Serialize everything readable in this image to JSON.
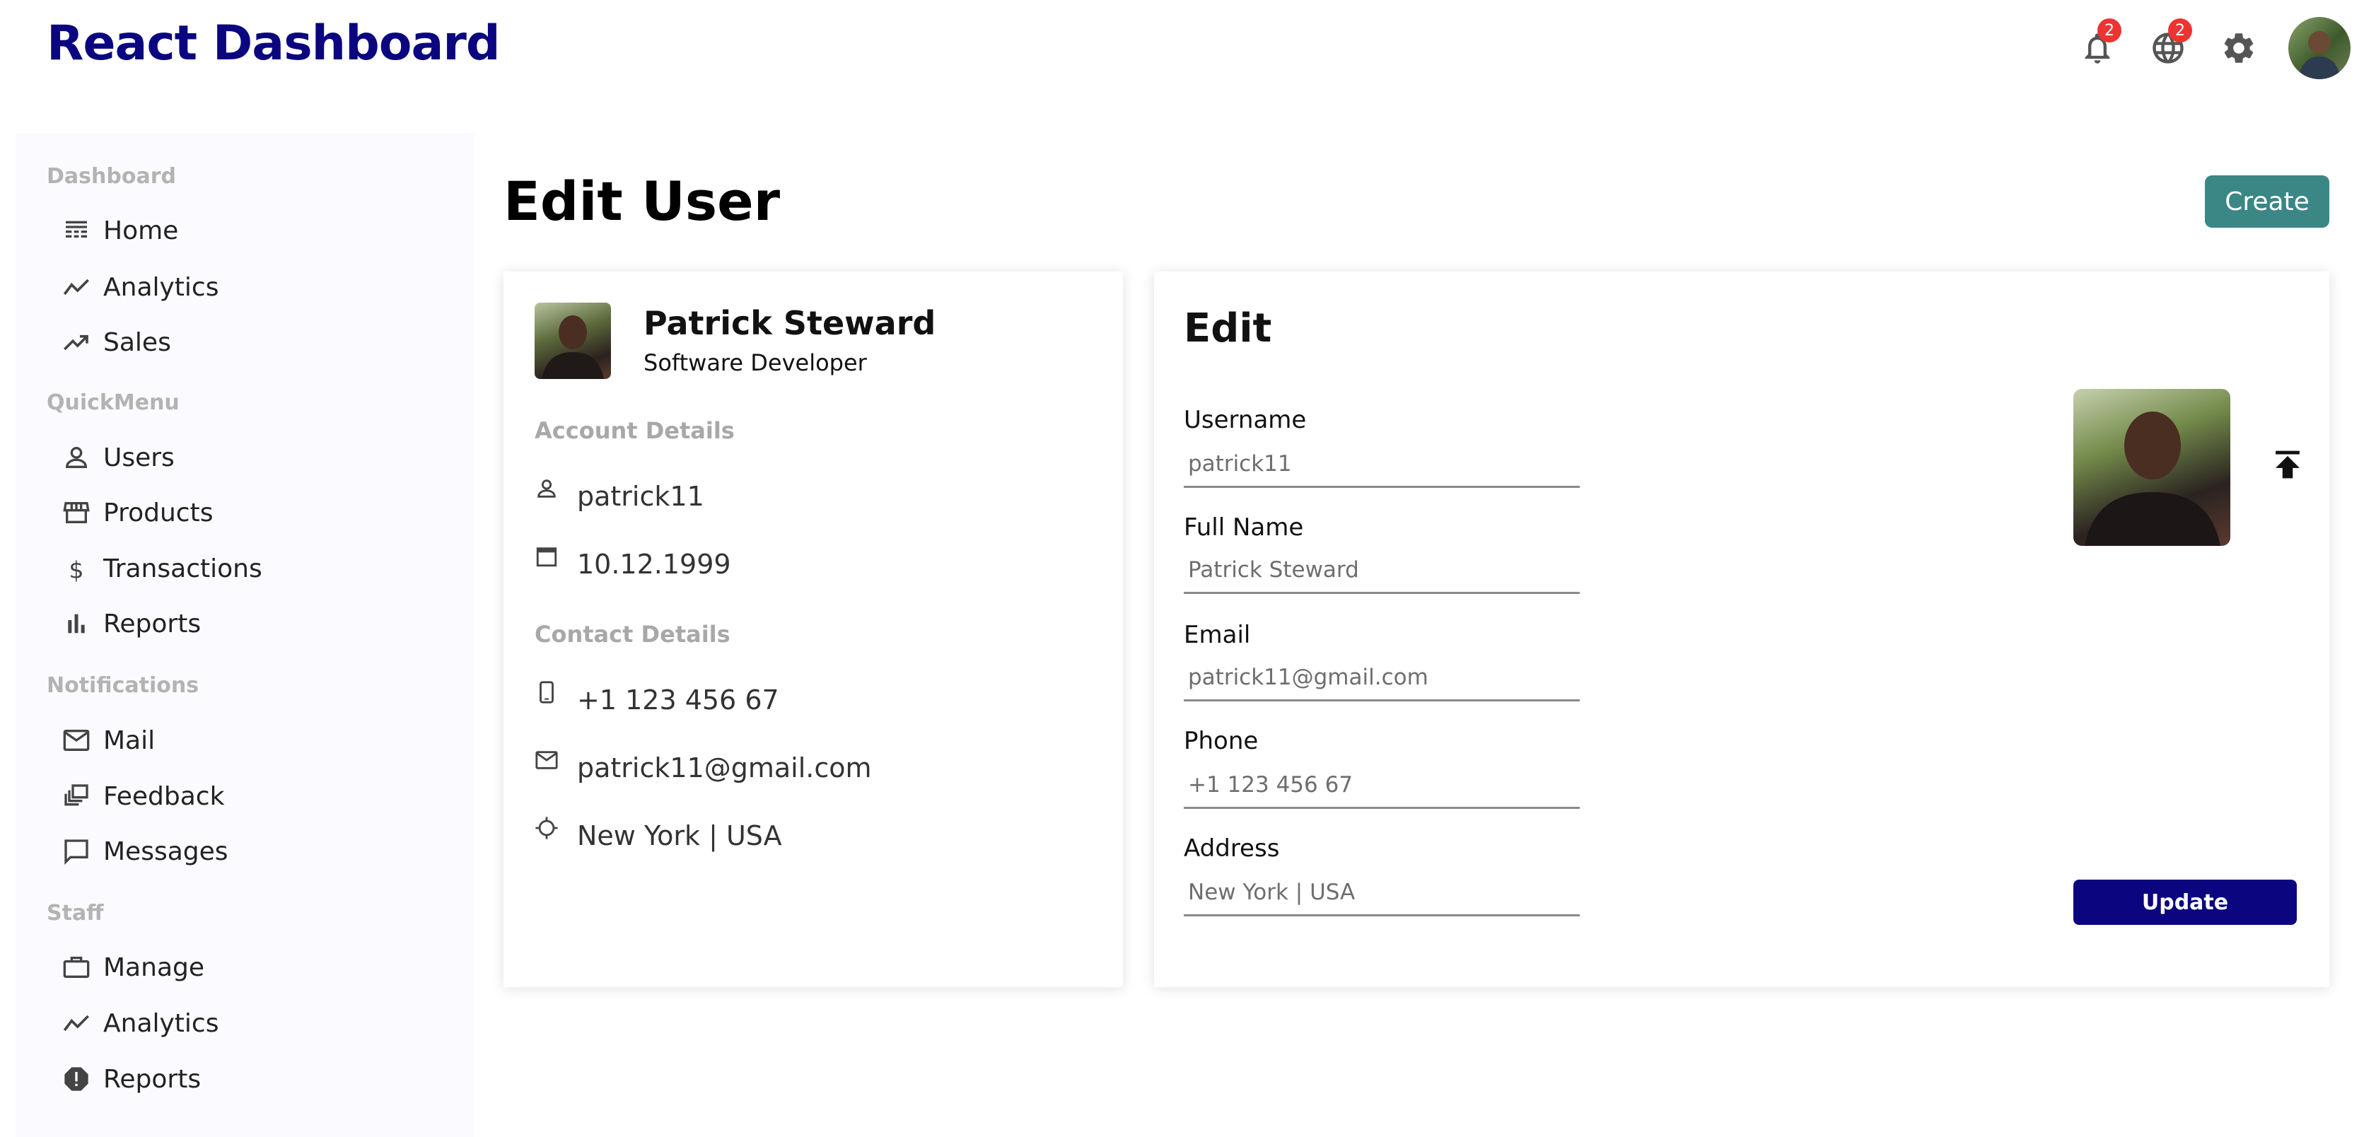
{
  "app": {
    "title": "React Dashboard"
  },
  "topbar": {
    "notifications_badge": "2",
    "language_badge": "2"
  },
  "sidebar": {
    "sections": [
      {
        "title": "Dashboard",
        "items": [
          {
            "label": "Home",
            "icon": "home-icon"
          },
          {
            "label": "Analytics",
            "icon": "timeline-icon"
          },
          {
            "label": "Sales",
            "icon": "trending-up-icon"
          }
        ]
      },
      {
        "title": "QuickMenu",
        "items": [
          {
            "label": "Users",
            "icon": "person-icon"
          },
          {
            "label": "Products",
            "icon": "storefront-icon"
          },
          {
            "label": "Transactions",
            "icon": "dollar-icon"
          },
          {
            "label": "Reports",
            "icon": "bar-chart-icon"
          }
        ]
      },
      {
        "title": "Notifications",
        "items": [
          {
            "label": "Mail",
            "icon": "mail-icon"
          },
          {
            "label": "Feedback",
            "icon": "dynamic-feed-icon"
          },
          {
            "label": "Messages",
            "icon": "chat-bubble-icon"
          }
        ]
      },
      {
        "title": "Staff",
        "items": [
          {
            "label": "Manage",
            "icon": "work-icon"
          },
          {
            "label": "Analytics",
            "icon": "timeline-icon"
          },
          {
            "label": "Reports",
            "icon": "report-icon"
          }
        ]
      }
    ]
  },
  "page": {
    "title": "Edit User",
    "create_label": "Create"
  },
  "user_card": {
    "name": "Patrick Steward",
    "role": "Software Developer",
    "account_title": "Account Details",
    "username": "patrick11",
    "birthday": "10.12.1999",
    "contact_title": "Contact Details",
    "phone": "+1 123 456 67",
    "email": "patrick11@gmail.com",
    "address": "New York | USA"
  },
  "edit_form": {
    "title": "Edit",
    "fields": [
      {
        "label": "Username",
        "placeholder": "patrick11"
      },
      {
        "label": "Full Name",
        "placeholder": "Patrick Steward"
      },
      {
        "label": "Email",
        "placeholder": "patrick11@gmail.com"
      },
      {
        "label": "Phone",
        "placeholder": "+1 123 456 67"
      },
      {
        "label": "Address",
        "placeholder": "New York | USA"
      }
    ],
    "update_label": "Update"
  }
}
